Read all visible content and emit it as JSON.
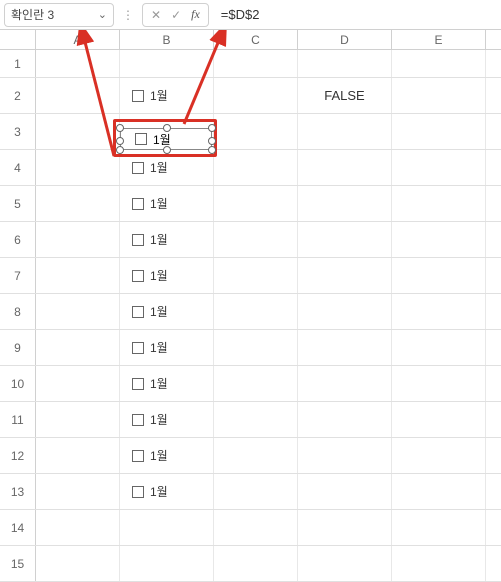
{
  "nameBox": {
    "value": "확인란 3"
  },
  "formulaBar": {
    "cancel": "✕",
    "confirm": "✓",
    "fx": "fx",
    "formula": "=$D$2"
  },
  "columns": [
    "A",
    "B",
    "C",
    "D",
    "E"
  ],
  "rows": [
    "1",
    "2",
    "3",
    "4",
    "5",
    "6",
    "7",
    "8",
    "9",
    "10",
    "11",
    "12",
    "13",
    "14",
    "15"
  ],
  "checkbox_label": "1월",
  "d2_value": "FALSE",
  "checkbox_rows": [
    2,
    3,
    4,
    5,
    6,
    7,
    8,
    9,
    10,
    11,
    12,
    13
  ],
  "icons": {
    "chevron": "⌄"
  }
}
